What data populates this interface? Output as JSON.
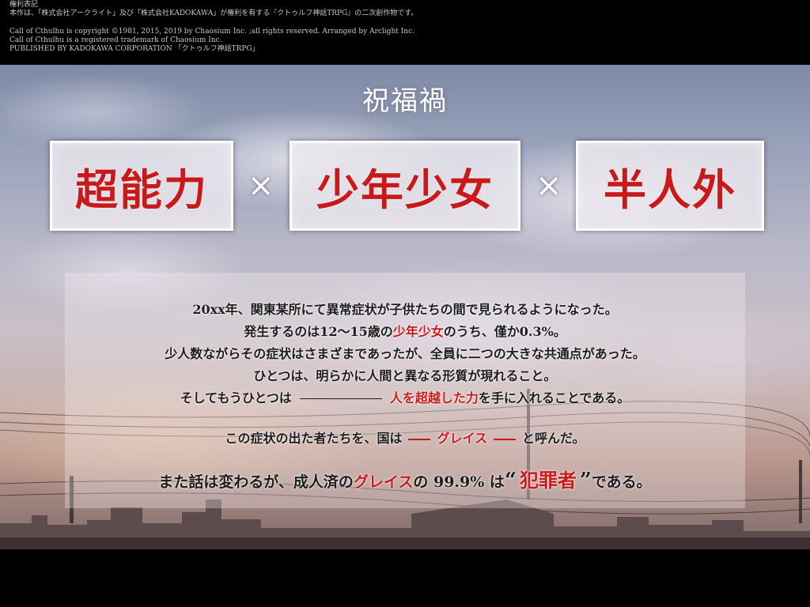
{
  "copyright": {
    "heading": "権利表記",
    "line1": "本作は、「株式会社アークライト」及び「株式会社KADOKAWA」が権利を有する『クトゥルフ神話TRPG』の二次創作物です。",
    "line2": "Call of Cthulhu is copyright ©1981, 2015, 2019 by Chaosium Inc. ;all rights reserved. Arranged by Arclight Inc.",
    "line3": "Call of Cthulhu is a registered trademark of Chaosium Inc.",
    "line4": "PUBLISHED BY KADOKAWA CORPORATION 「クトゥルフ神話TRPG」"
  },
  "title": "祝福禍",
  "keywords": [
    "超能力",
    "少年少女",
    "半人外"
  ],
  "separator": "×",
  "story": {
    "line1": "20xx年、関東某所にて異常症状が子供たちの間で見られるようになった。",
    "line2": {
      "pre": "発生するのは12〜15歳の",
      "red": "少年少女",
      "post": "のうち、僅か0.3%。"
    },
    "line3": "少人数ながらその症状はさまざまであったが、全員に二つの大きな共通点があった。",
    "line4": "ひとつは、明らかに人間と異なる形質が現れること。",
    "line5": {
      "pre": "そしてもうひとつは",
      "red": "人を超越した力",
      "post": "を手に入れることである。"
    },
    "line6": {
      "pre": "この症状の出た者たちを、国は",
      "red": "グレイス",
      "post": "と呼んだ。"
    },
    "line7": {
      "pre": "また話は変わるが、成人済の",
      "red": "グレイス",
      "mid": "の 99.9% は",
      "open_quote": "“",
      "crime": "犯罪者",
      "close_quote": "”",
      "post": "である。"
    }
  },
  "colors": {
    "accent_red": "#c81a1a",
    "background": "#000000",
    "text_dark": "#1c1c1c"
  }
}
